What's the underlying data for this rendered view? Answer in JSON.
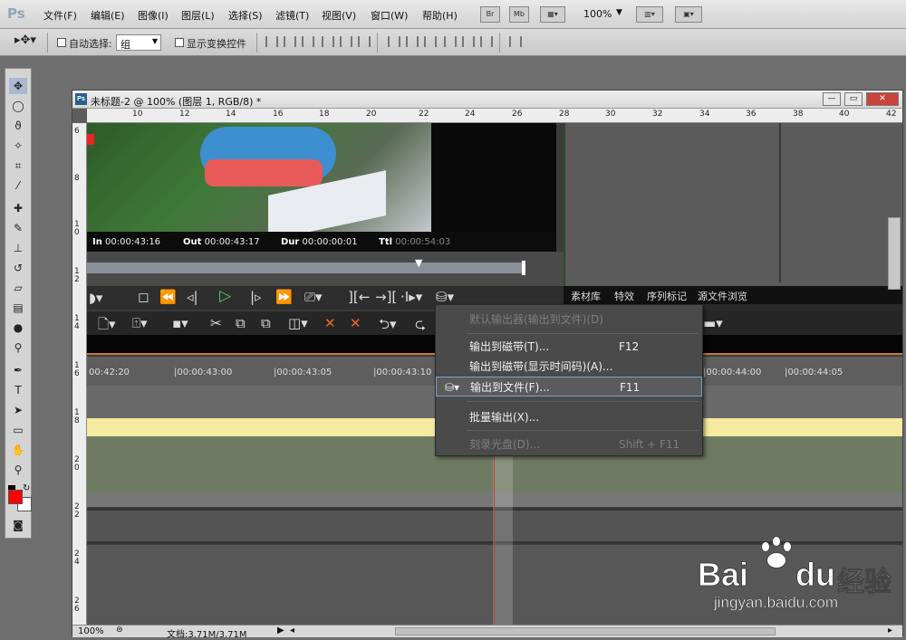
{
  "menubar": {
    "logo": "Ps",
    "items": [
      "文件(F)",
      "编辑(E)",
      "图像(I)",
      "图层(L)",
      "选择(S)",
      "滤镜(T)",
      "视图(V)",
      "窗口(W)",
      "帮助(H)"
    ],
    "btn_br": "Br",
    "btn_mb": "Mb",
    "zoom": "100%"
  },
  "options": {
    "autoselect_label": "自动选择:",
    "autoselect_value": "组",
    "show_transform_label": "显示变换控件"
  },
  "document": {
    "title": "未标题-2 @ 100% (图层 1, RGB/8) *",
    "zoom": "100%",
    "file_size": "文档:3.71M/3.71M"
  },
  "ruler": {
    "h_labels": [
      "10",
      "12",
      "14",
      "16",
      "18",
      "20",
      "22",
      "24",
      "26",
      "28",
      "30",
      "32",
      "34",
      "36",
      "38",
      "40",
      "42"
    ],
    "v_labels": [
      "6",
      "8",
      "1\n0",
      "1\n2",
      "1\n4",
      "1\n6",
      "1\n8",
      "2\n0",
      "2\n2",
      "2\n4",
      "2\n6"
    ]
  },
  "editor": {
    "in_label": "In",
    "in_value": "00:00:43:16",
    "out_label": "Out",
    "out_value": "00:00:43:17",
    "dur_label": "Dur",
    "dur_value": "00:00:00:01",
    "ttl_label": "Ttl",
    "ttl_value": "00:00:54:03",
    "panel_tabs": [
      "素材库",
      "特效",
      "序列标记",
      "源文件浏览"
    ],
    "timeline_ticks": [
      "00:42:20",
      "|00:00:43:00",
      "|00:00:43:05",
      "|00:00:43:10",
      "|00:00:44:00",
      "|00:00:44:05"
    ]
  },
  "context_menu": {
    "items": [
      {
        "label": "默认输出器(输出到文件)(D)",
        "shortcut": "",
        "disabled": true
      },
      {
        "label": "输出到磁带(T)...",
        "shortcut": "F12",
        "disabled": false
      },
      {
        "label": "输出到磁带(显示时间码)(A)...",
        "shortcut": "",
        "disabled": false
      },
      {
        "label": "输出到文件(F)...",
        "shortcut": "F11",
        "disabled": false
      },
      {
        "label": "批量输出(X)...",
        "shortcut": "",
        "disabled": false
      },
      {
        "label": "刻录光盘(D)...",
        "shortcut": "Shift + F11",
        "disabled": true
      }
    ]
  },
  "watermark": {
    "brand": "Bai",
    "brand2": "du",
    "cn": "经验",
    "url": "jingyan.baidu.com"
  },
  "colors": {
    "fg": "#ff0000",
    "bg": "#ffffff",
    "accent": "#7aa1cf",
    "play": "#4ed05b"
  }
}
